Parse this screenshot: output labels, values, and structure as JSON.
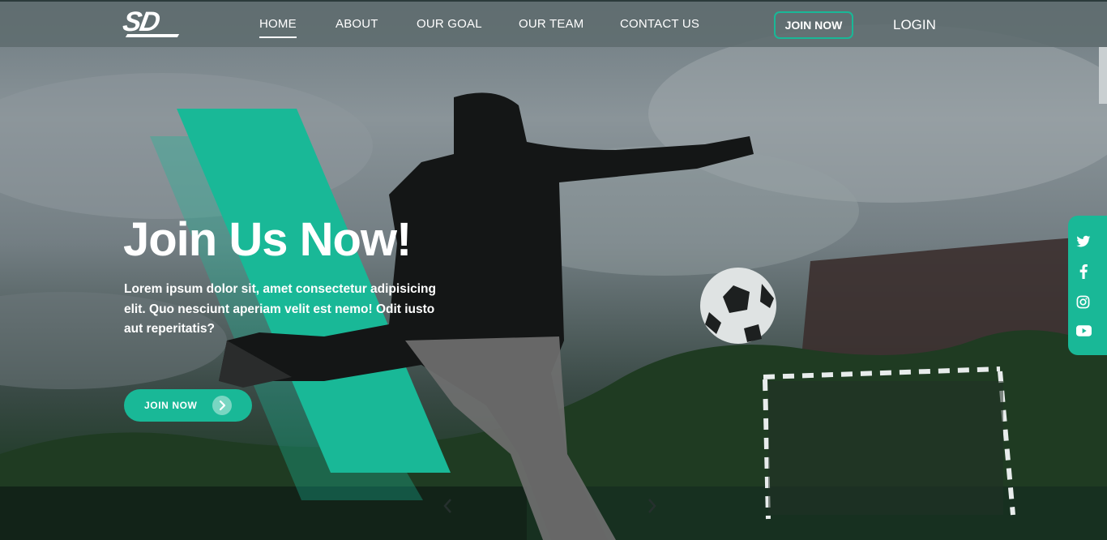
{
  "brand": {
    "logo_text": "SD"
  },
  "nav": {
    "items": [
      {
        "label": "HOME",
        "active": true
      },
      {
        "label": "ABOUT",
        "active": false
      },
      {
        "label": "OUR GOAL",
        "active": false
      },
      {
        "label": "OUR TEAM",
        "active": false
      },
      {
        "label": "CONTACT US",
        "active": false
      }
    ],
    "join_label": "JOIN NOW",
    "login_label": "LOGIN"
  },
  "hero": {
    "title": "Join Us Now!",
    "text": "Lorem ipsum dolor sit, amet consectetur adipisicing elit. Quo nesciunt aperiam velit est nemo! Odit iusto aut reperitatis?",
    "cta_label": "JOIN NOW"
  },
  "carousel": {
    "prev_icon": "chevron-left-icon",
    "next_icon": "chevron-right-icon"
  },
  "social": [
    {
      "icon": "twitter-icon"
    },
    {
      "icon": "facebook-icon"
    },
    {
      "icon": "instagram-icon"
    },
    {
      "icon": "youtube-icon"
    }
  ],
  "colors": {
    "accent": "#19b897",
    "nav_bg": "#5f6c6e",
    "text": "#ffffff"
  }
}
